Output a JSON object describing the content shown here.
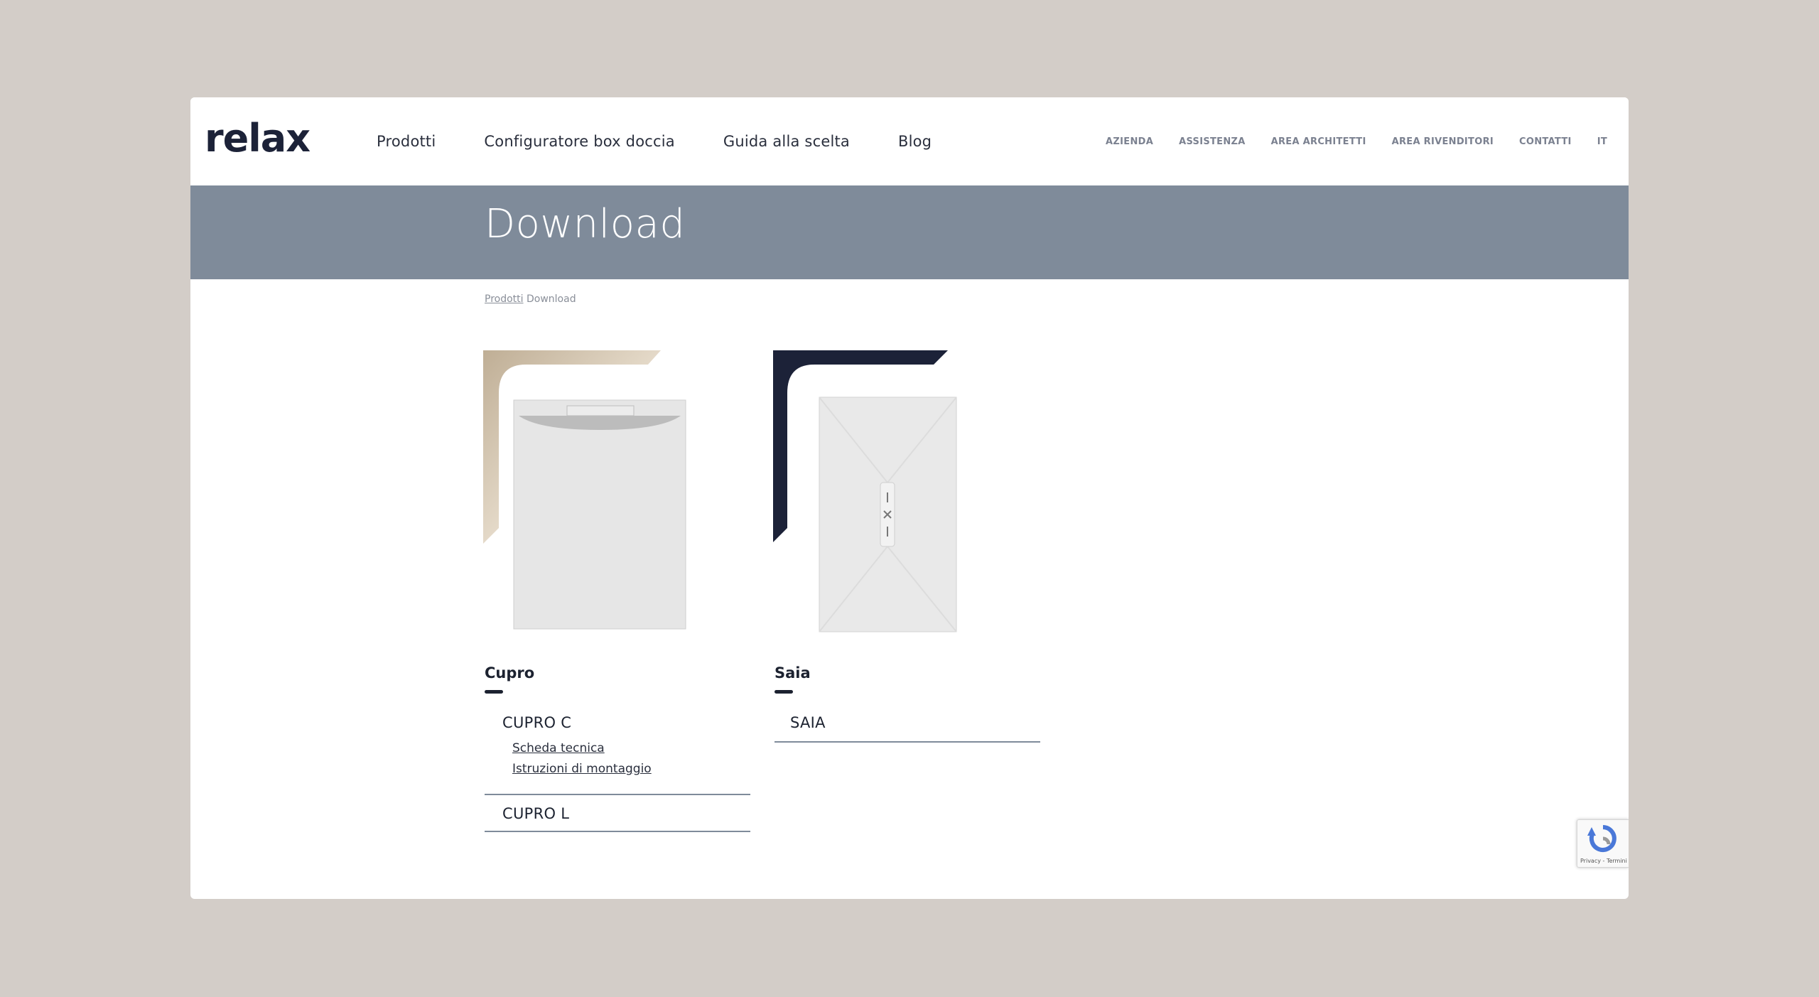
{
  "brand": {
    "name": "relax",
    "color": "#1c2238"
  },
  "main_nav": [
    {
      "label": "Prodotti"
    },
    {
      "label": "Configuratore box doccia"
    },
    {
      "label": "Guida alla scelta"
    },
    {
      "label": "Blog"
    }
  ],
  "top_nav": [
    {
      "label": "AZIENDA"
    },
    {
      "label": "ASSISTENZA"
    },
    {
      "label": "AREA ARCHITETTI"
    },
    {
      "label": "AREA RIVENDITORI"
    },
    {
      "label": "CONTATTI"
    },
    {
      "label": "IT"
    }
  ],
  "banner": {
    "title": "Download",
    "color": "#7f8b9a"
  },
  "breadcrumb": {
    "parent": "Prodotti",
    "current": "Download"
  },
  "products": [
    {
      "title": "Cupro",
      "accent_color": "#c8b79f",
      "models": [
        {
          "name": "CUPRO C",
          "links": [
            "Scheda tecnica",
            "Istruzioni di montaggio"
          ]
        },
        {
          "name": "CUPRO L"
        }
      ]
    },
    {
      "title": "Saia",
      "accent_color": "#1c2238",
      "models": [
        {
          "name": "SAIA"
        }
      ]
    }
  ],
  "recaptcha": {
    "text": "Privacy - Termini"
  }
}
